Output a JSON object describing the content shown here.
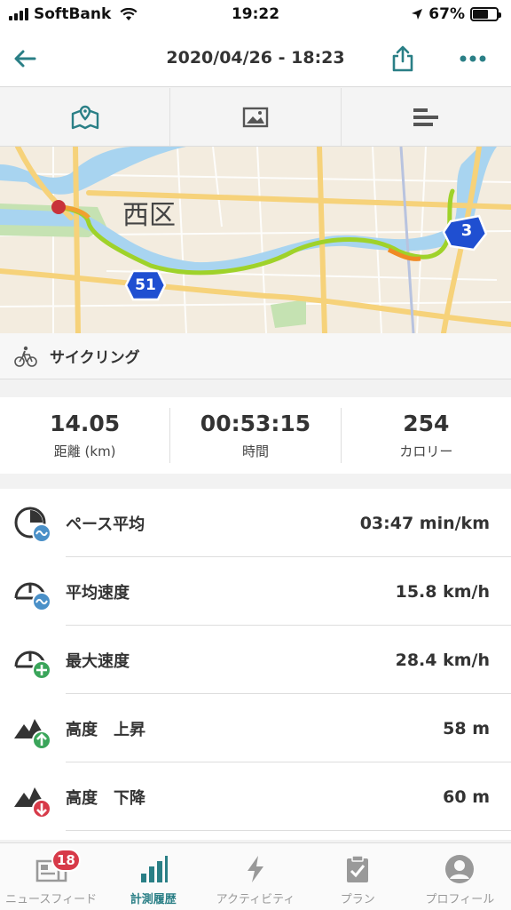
{
  "status_bar": {
    "carrier": "SoftBank",
    "time": "19:22",
    "battery_percent": "67%",
    "battery_level": 0.67
  },
  "header": {
    "title": "2020/04/26 - 18:23",
    "back_icon": "arrow-left-icon",
    "share_icon": "share-icon",
    "more_icon": "more-dots-icon"
  },
  "tabs": [
    {
      "icon": "map-icon"
    },
    {
      "icon": "photo-icon"
    },
    {
      "icon": "bar-chart-icon"
    }
  ],
  "map": {
    "district_label": "西区",
    "route_shield_1": "51",
    "route_shield_2": "3"
  },
  "activity": {
    "label": "サイクリング",
    "icon": "cyclist-icon"
  },
  "summary": [
    {
      "value": "14.05",
      "label": "距離 (km)"
    },
    {
      "value": "00:53:15",
      "label": "時間"
    },
    {
      "value": "254",
      "label": "カロリー"
    }
  ],
  "stats": [
    {
      "label": "ペース平均",
      "value": "03:47 min/km",
      "icon": "pace-average-icon"
    },
    {
      "label": "平均速度",
      "value": "15.8 km/h",
      "icon": "speed-average-icon"
    },
    {
      "label": "最大速度",
      "value": "28.4 km/h",
      "icon": "speed-max-icon"
    },
    {
      "label": "高度　上昇",
      "value": "58 m",
      "icon": "elevation-up-icon"
    },
    {
      "label": "高度　下降",
      "value": "60 m",
      "icon": "elevation-down-icon"
    }
  ],
  "tabbar": {
    "badge": "18",
    "items": [
      {
        "label": "ニュースフィード",
        "icon": "newsfeed-icon"
      },
      {
        "label": "計測履歴",
        "icon": "history-icon"
      },
      {
        "label": "アクティビティ",
        "icon": "activity-icon"
      },
      {
        "label": "プラン",
        "icon": "plan-icon"
      },
      {
        "label": "プロフィール",
        "icon": "profile-icon"
      }
    ]
  },
  "colors": {
    "accent": "#2a7f86",
    "badge": "#d73a49",
    "river": "#a8d4f0",
    "road": "#f6d27a"
  }
}
